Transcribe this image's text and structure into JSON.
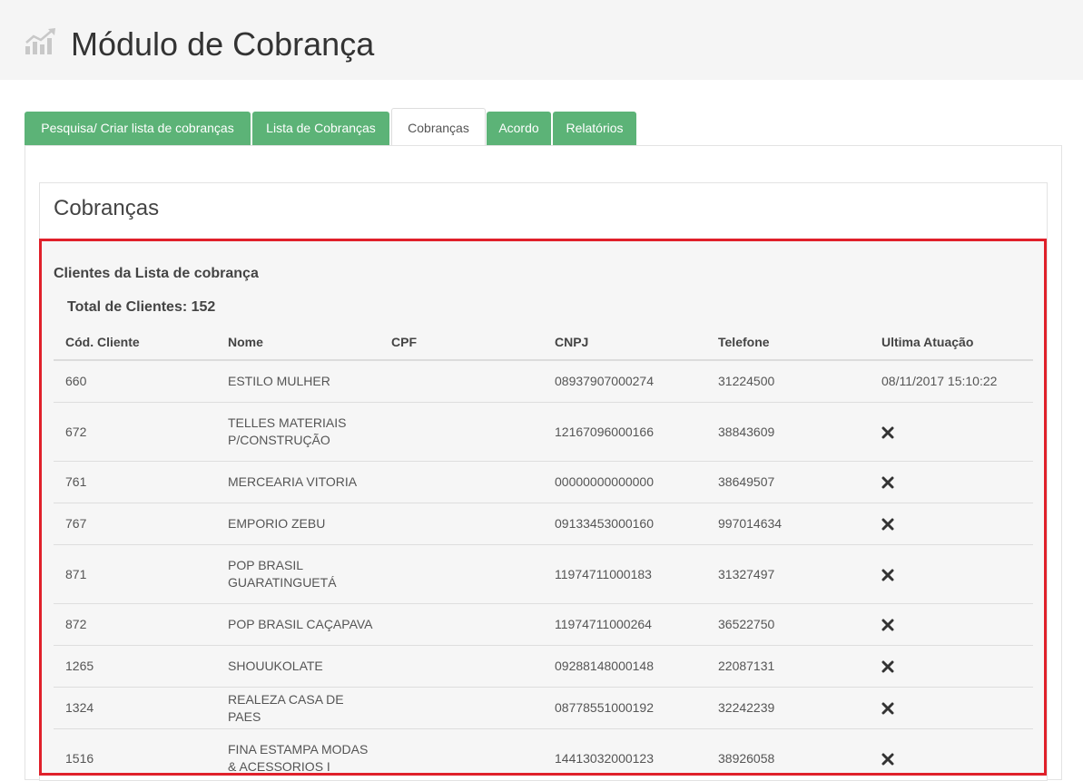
{
  "header": {
    "title": "Módulo de Cobrança",
    "logo_icon": "bar-chart-trend-icon"
  },
  "tabs": [
    {
      "label": "Pesquisa/ Criar lista de cobranças",
      "active": false
    },
    {
      "label": "Lista de Cobranças",
      "active": false
    },
    {
      "label": "Cobranças",
      "active": true
    },
    {
      "label": "Acordo",
      "active": false
    },
    {
      "label": "Relatórios",
      "active": false
    }
  ],
  "panel": {
    "title": "Cobranças",
    "section_title": "Clientes da Lista de cobrança",
    "total_label": "Total de Clientes: 152"
  },
  "table": {
    "columns": [
      "Cód. Cliente",
      "Nome",
      "CPF",
      "CNPJ",
      "Telefone",
      "Ultima Atuação"
    ],
    "rows": [
      {
        "cod": "660",
        "nome": [
          "ESTILO MULHER"
        ],
        "cpf": "",
        "cnpj": "08937907000274",
        "telefone": "31224500",
        "ultima": "08/11/2017 15:10:22"
      },
      {
        "cod": "672",
        "nome": [
          "TELLES MATERIAIS",
          "P/CONSTRUÇÃO"
        ],
        "cpf": "",
        "cnpj": "12167096000166",
        "telefone": "38843609",
        "ultima": null
      },
      {
        "cod": "761",
        "nome": [
          "MERCEARIA VITORIA"
        ],
        "cpf": "",
        "cnpj": "00000000000000",
        "telefone": "38649507",
        "ultima": null
      },
      {
        "cod": "767",
        "nome": [
          "EMPORIO ZEBU"
        ],
        "cpf": "",
        "cnpj": "09133453000160",
        "telefone": "997014634",
        "ultima": null
      },
      {
        "cod": "871",
        "nome": [
          "POP BRASIL",
          "GUARATINGUETÁ"
        ],
        "cpf": "",
        "cnpj": "11974711000183",
        "telefone": "31327497",
        "ultima": null
      },
      {
        "cod": "872",
        "nome": [
          "POP BRASIL CAÇAPAVA"
        ],
        "cpf": "",
        "cnpj": "11974711000264",
        "telefone": "36522750",
        "ultima": null
      },
      {
        "cod": "1265",
        "nome": [
          "SHOUUKOLATE"
        ],
        "cpf": "",
        "cnpj": "09288148000148",
        "telefone": "22087131",
        "ultima": null
      },
      {
        "cod": "1324",
        "nome": [
          "REALEZA CASA DE PAES"
        ],
        "cpf": "",
        "cnpj": "08778551000192",
        "telefone": "32242239",
        "ultima": null
      },
      {
        "cod": "1516",
        "nome": [
          "FINA ESTAMPA MODAS",
          "& ACESSORIOS I"
        ],
        "cpf": "",
        "cnpj": "14413032000123",
        "telefone": "38926058",
        "ultima": null
      }
    ],
    "empty_marker_icon": "x-icon"
  },
  "colors": {
    "tab_green": "#5cb377",
    "highlight_border": "#e0202a",
    "header_bg": "#f5f5f5"
  }
}
